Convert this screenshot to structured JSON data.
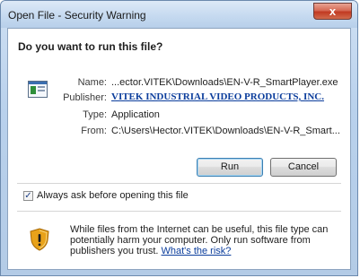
{
  "window": {
    "title": "Open File - Security Warning",
    "close_glyph": "x"
  },
  "question": "Do you want to run this file?",
  "file_icon": "application-window-icon",
  "fields": {
    "name_label": "Name:",
    "name_value": "...ector.VITEK\\Downloads\\EN-V-R_SmartPlayer.exe",
    "publisher_label": "Publisher:",
    "publisher_value": "VITEK INDUSTRIAL VIDEO PRODUCTS, INC.",
    "type_label": "Type:",
    "type_value": "Application",
    "from_label": "From:",
    "from_value": "C:\\Users\\Hector.VITEK\\Downloads\\EN-V-R_Smart..."
  },
  "buttons": {
    "run": "Run",
    "cancel": "Cancel"
  },
  "checkbox": {
    "label": "Always ask before opening this file",
    "checked": true,
    "mark": "✓"
  },
  "warning": {
    "text": "While files from the Internet can be useful, this file type can potentially harm your computer. Only run software from publishers you trust.",
    "link": "What's the risk?",
    "icon": "shield-warning-icon"
  },
  "colors": {
    "link": "#0b3d9c",
    "close_red": "#c13a22"
  }
}
